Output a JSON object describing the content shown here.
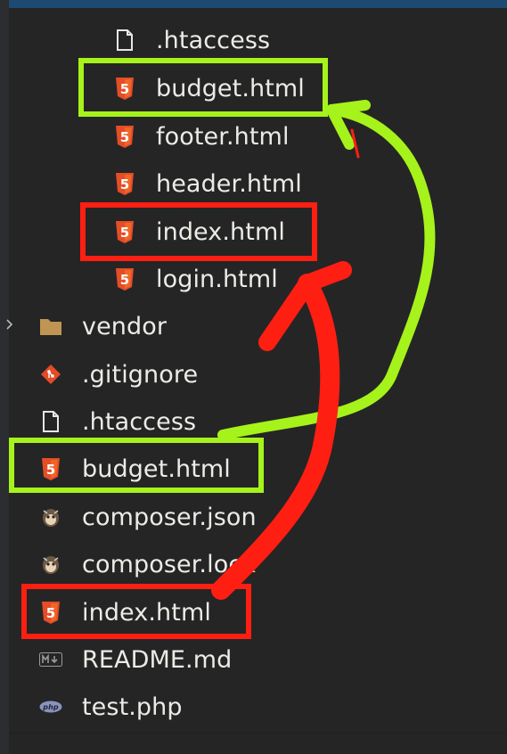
{
  "explorer": {
    "nested_items": [
      {
        "label": ".htaccess",
        "icon": "file-icon"
      },
      {
        "label": "budget.html",
        "icon": "html5-icon"
      },
      {
        "label": "footer.html",
        "icon": "html5-icon"
      },
      {
        "label": "header.html",
        "icon": "html5-icon"
      },
      {
        "label": "index.html",
        "icon": "html5-icon"
      },
      {
        "label": "login.html",
        "icon": "html5-icon"
      }
    ],
    "root_items": [
      {
        "label": "vendor",
        "icon": "folder-icon"
      },
      {
        "label": ".gitignore",
        "icon": "git-icon"
      },
      {
        "label": ".htaccess",
        "icon": "file-icon"
      },
      {
        "label": "budget.html",
        "icon": "html5-icon"
      },
      {
        "label": "composer.json",
        "icon": "composer-icon"
      },
      {
        "label": "composer.lock",
        "icon": "composer-icon"
      },
      {
        "label": "index.html",
        "icon": "html5-icon"
      },
      {
        "label": "README.md",
        "icon": "markdown-icon"
      },
      {
        "label": "test.php",
        "icon": "php-icon"
      }
    ]
  },
  "annotations": {
    "green": "#a6f21b",
    "red": "#ff1f12"
  },
  "colors": {
    "html5": "#e44d26",
    "folder": "#c09553",
    "git": "#e34c26",
    "text": "#ecebe6"
  }
}
